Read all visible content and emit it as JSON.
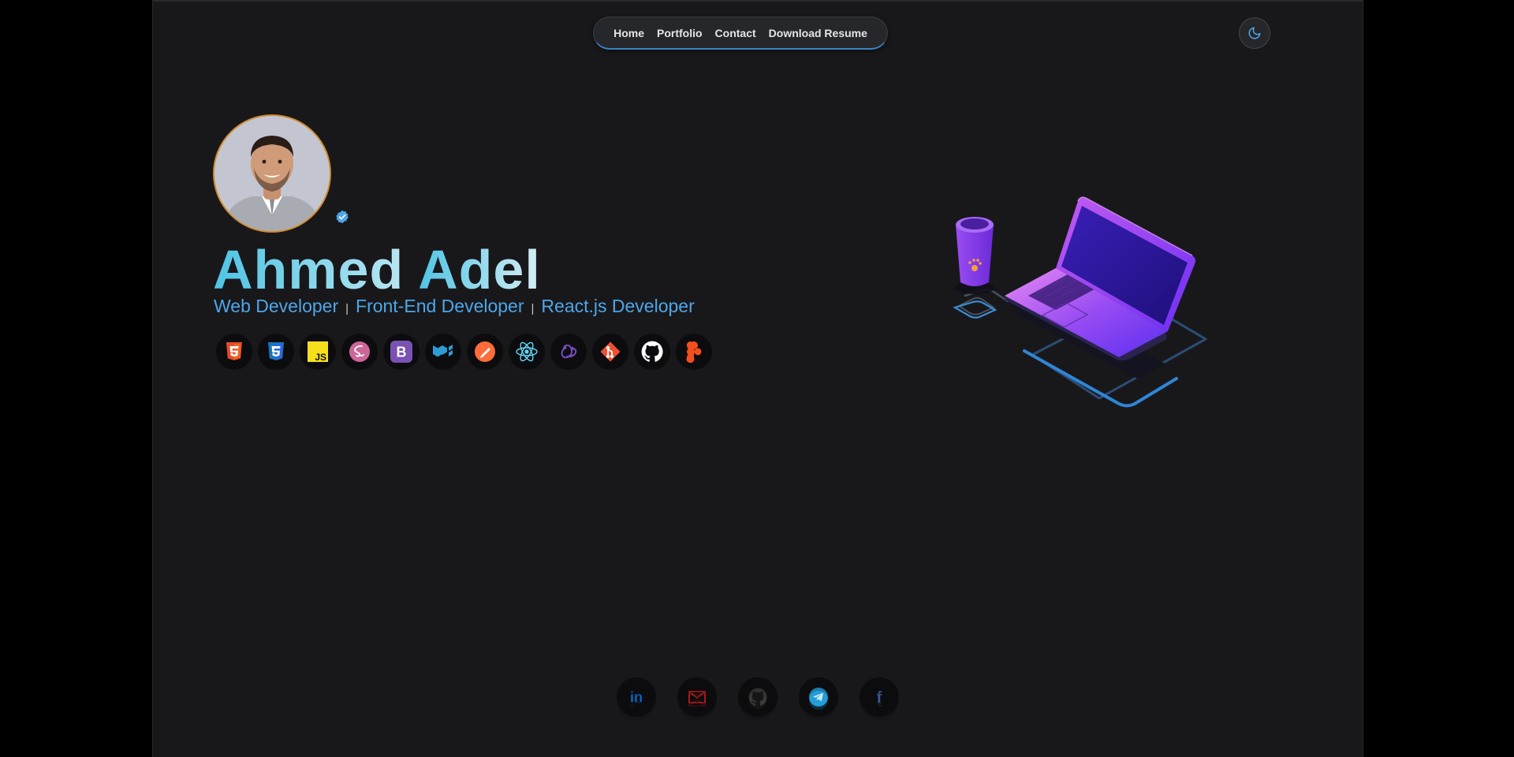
{
  "nav": {
    "items": [
      {
        "label": "Home"
      },
      {
        "label": "Portfolio"
      },
      {
        "label": "Contact"
      },
      {
        "label": "Download Resume"
      }
    ]
  },
  "theme_toggle": {
    "icon": "moon-icon",
    "color": "#4ea6e8"
  },
  "profile": {
    "name_first": "Ahmed",
    "name_last": "Adel",
    "verified_icon": "verified-badge-icon",
    "roles": [
      "Web Developer",
      "Front-End Developer",
      "React.js Developer"
    ],
    "role_separator": "|"
  },
  "skills": [
    {
      "icon": "html5-icon",
      "color": "#e44d26"
    },
    {
      "icon": "css3-icon",
      "color": "#2965f1"
    },
    {
      "icon": "javascript-icon",
      "color": "#f7df1e",
      "text": "JS"
    },
    {
      "icon": "sass-icon",
      "color": "#cc6699"
    },
    {
      "icon": "bootstrap-icon",
      "color": "#7952b3",
      "text": "B"
    },
    {
      "icon": "material-ui-icon",
      "color": "#2e9bd6"
    },
    {
      "icon": "postman-icon",
      "color": "#ff6c37"
    },
    {
      "icon": "react-icon",
      "color": "#61dafb"
    },
    {
      "icon": "redux-icon",
      "color": "#764abc"
    },
    {
      "icon": "git-icon",
      "color": "#f05032"
    },
    {
      "icon": "github-icon",
      "color": "#ffffff"
    },
    {
      "icon": "figma-icon",
      "color": "#f24e1e"
    }
  ],
  "social": [
    {
      "icon": "linkedin-icon",
      "color": "#0a66c2",
      "text": "in"
    },
    {
      "icon": "email-icon",
      "color": "#b91c1c"
    },
    {
      "icon": "github-icon",
      "color": "#3a3a3a"
    },
    {
      "icon": "telegram-icon",
      "color": "#229ed9"
    },
    {
      "icon": "facebook-icon",
      "color": "#3b5998",
      "text": "f"
    }
  ],
  "colors": {
    "background": "#18181b",
    "accent": "#4ea6e8",
    "name_gradient_start": "#4ec4e4",
    "avatar_border": "#d08a2a"
  }
}
